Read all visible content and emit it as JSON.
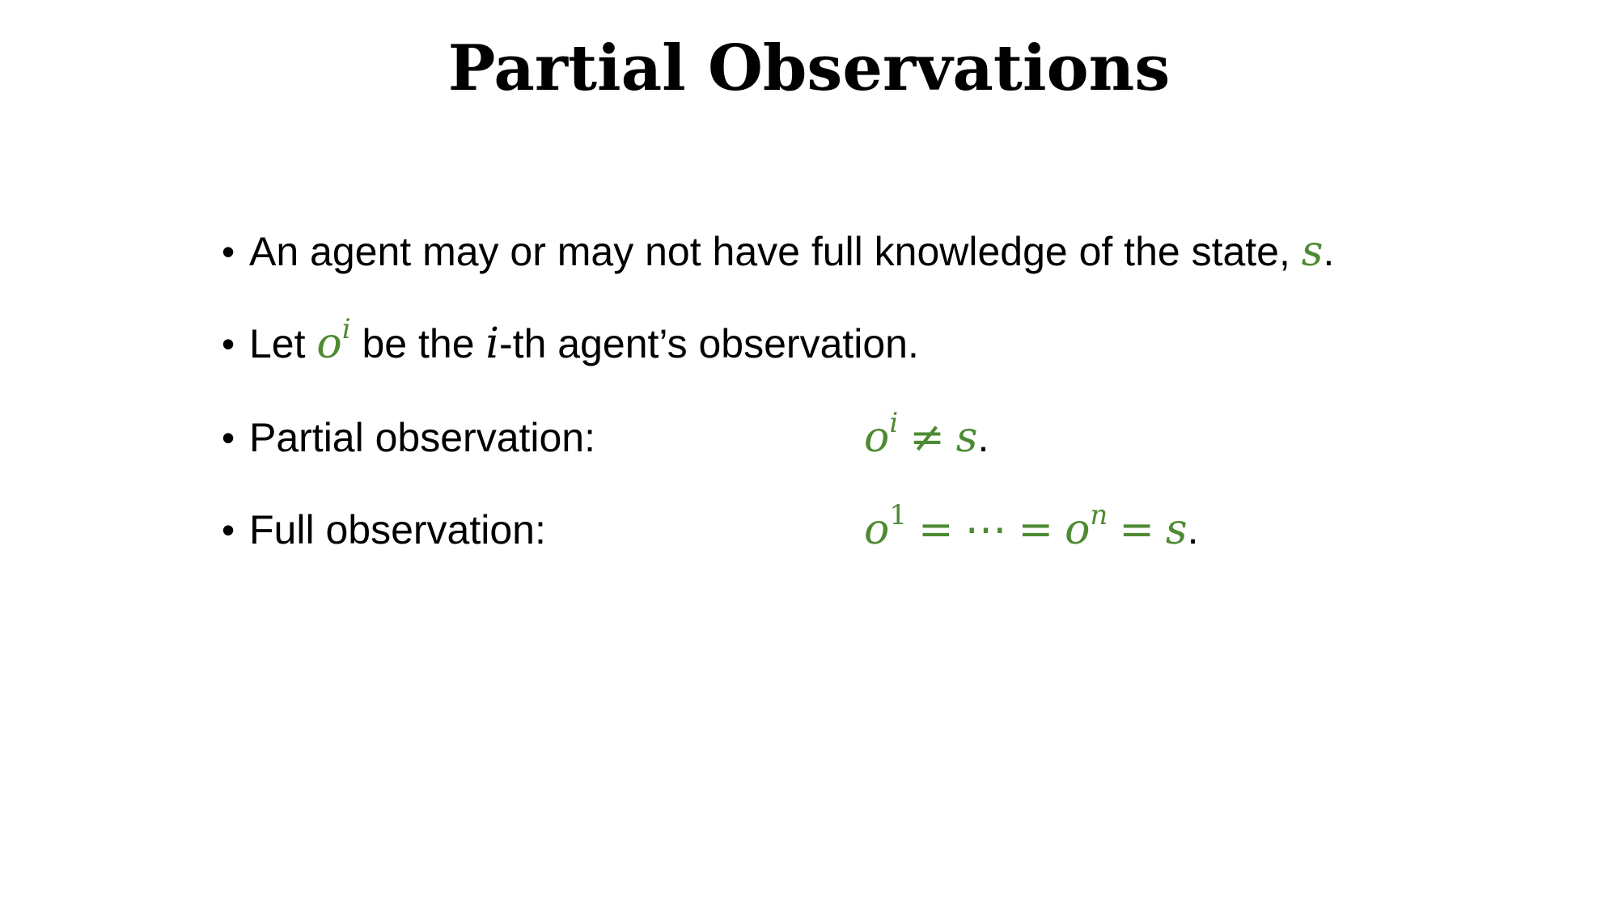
{
  "slide": {
    "title": "Partial Observations",
    "bullet_symbol": "•",
    "accent_color": "#4e8a33",
    "bullets": [
      {
        "text_before": "An agent may or may not have full knowledge of the state, ",
        "var_s": "s",
        "period": "."
      },
      {
        "text_let": "Let ",
        "var_o": "o",
        "sup_i": "i",
        "text_mid": " be the ",
        "var_i": "i",
        "text_after": "-th agent’s observation."
      },
      {
        "label": "Partial observation:",
        "var_o": "o",
        "sup_i": "i",
        "neq": "≠",
        "var_s": "s",
        "period": "."
      },
      {
        "label": "Full observation:",
        "var_o1": "o",
        "sup_1": "1",
        "eq1": "=",
        "ellipsis": "⋯",
        "eq2": "=",
        "var_on": "o",
        "sup_n": "n",
        "eq3": "=",
        "var_s": "s",
        "period": "."
      }
    ]
  }
}
